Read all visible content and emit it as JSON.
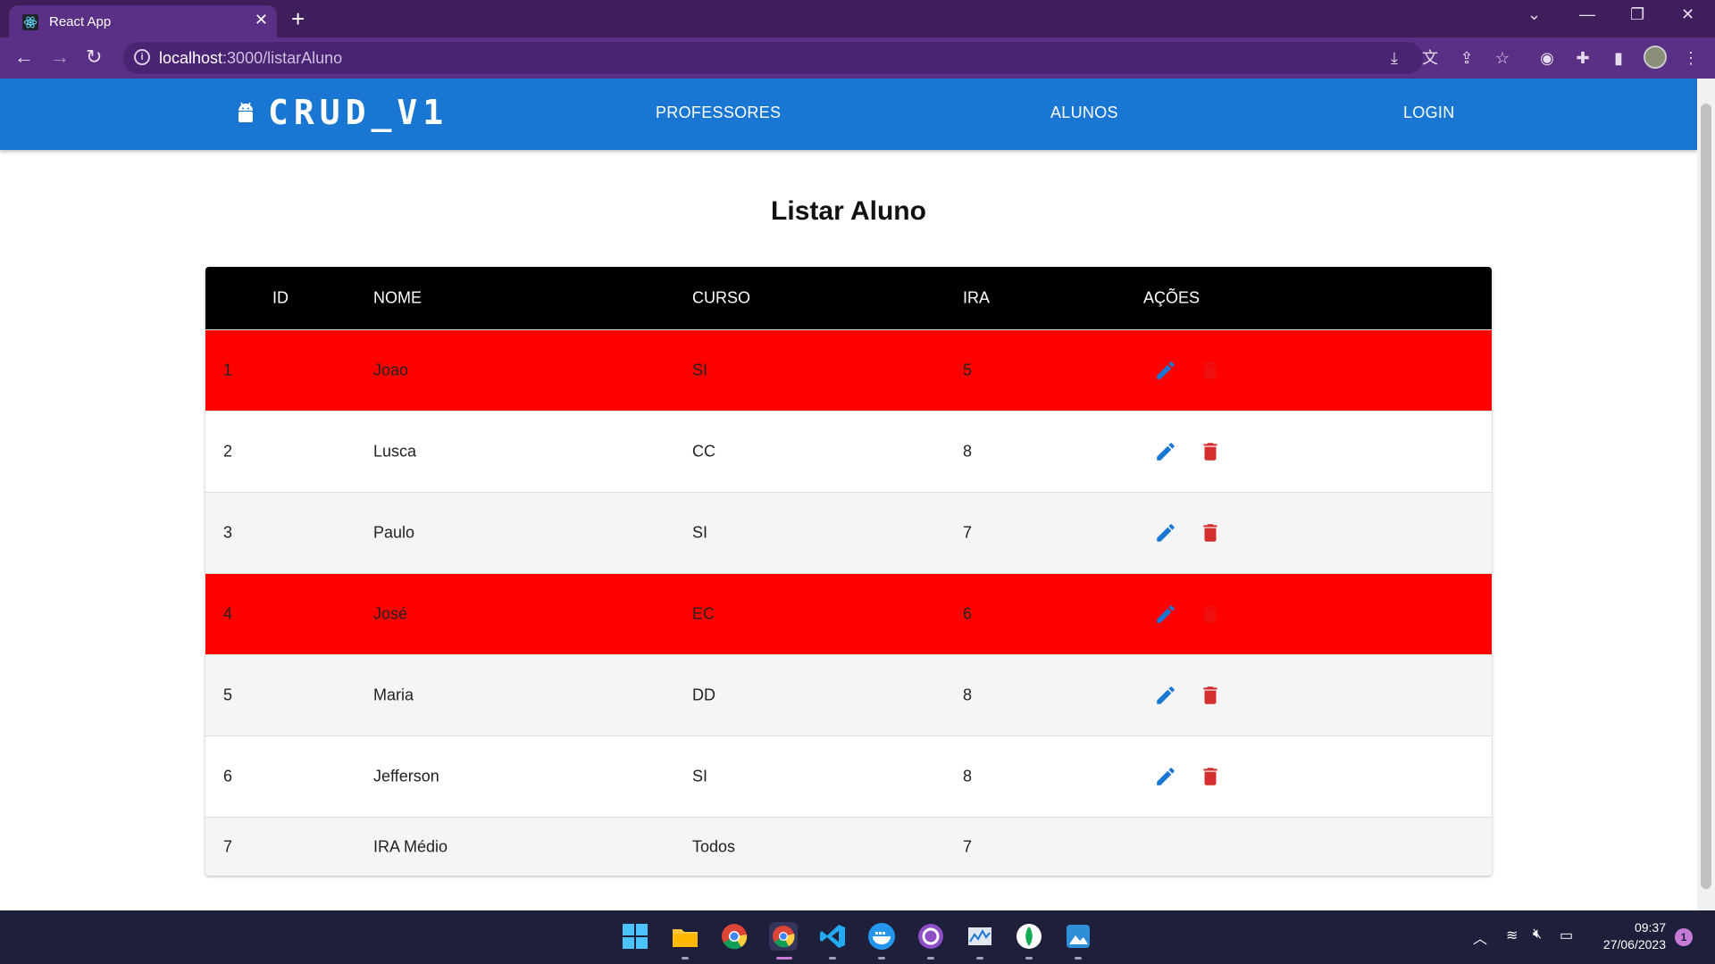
{
  "browser": {
    "tab_title": "React App",
    "url_host": "localhost",
    "url_rest": ":3000/listarAluno"
  },
  "navbar": {
    "brand": "CRUD_V1",
    "links": [
      "PROFESSORES",
      "ALUNOS",
      "LOGIN"
    ]
  },
  "page_title": "Listar Aluno",
  "table": {
    "headers": [
      "ID",
      "NOME",
      "CURSO",
      "IRA",
      "AÇÕES"
    ],
    "rows": [
      {
        "id": "1",
        "nome": "Joao",
        "curso": "SI",
        "ira": "5",
        "highlight": true,
        "actions": true
      },
      {
        "id": "2",
        "nome": "Lusca",
        "curso": "CC",
        "ira": "8",
        "highlight": false,
        "actions": true
      },
      {
        "id": "3",
        "nome": "Paulo",
        "curso": "SI",
        "ira": "7",
        "highlight": false,
        "actions": true
      },
      {
        "id": "4",
        "nome": "José",
        "curso": "EC",
        "ira": "6",
        "highlight": true,
        "actions": true
      },
      {
        "id": "5",
        "nome": "Maria",
        "curso": "DD",
        "ira": "8",
        "highlight": false,
        "actions": true
      },
      {
        "id": "6",
        "nome": "Jefferson",
        "curso": "SI",
        "ira": "8",
        "highlight": false,
        "actions": true
      },
      {
        "id": "7",
        "nome": "IRA Médio",
        "curso": "Todos",
        "ira": "7",
        "highlight": false,
        "actions": false
      }
    ]
  },
  "taskbar": {
    "time": "09:37",
    "date": "27/06/2023",
    "notifications": "1"
  },
  "colors": {
    "appbar": "#1976d2",
    "highlight_row": "#ff0000",
    "edit_icon": "#1976d2",
    "delete_icon": "#d32f2f"
  }
}
